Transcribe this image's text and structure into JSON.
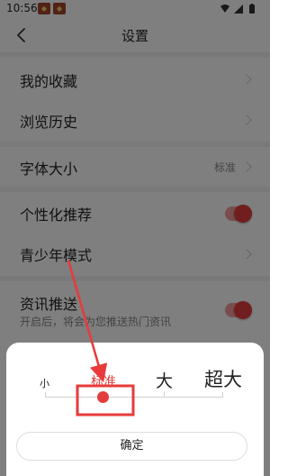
{
  "status_bar": {
    "time": "10:56"
  },
  "header": {
    "title": "设置"
  },
  "settings": {
    "favorites": "我的收藏",
    "history": "浏览历史",
    "font_size": {
      "label": "字体大小",
      "value": "标准"
    },
    "personalized": "个性化推荐",
    "teen_mode": "青少年模式",
    "news_push": {
      "label": "资讯推送",
      "subtitle": "开启后，将会为您推送热门资讯"
    }
  },
  "font_sheet": {
    "options": [
      "小",
      "标准",
      "大",
      "超大"
    ],
    "selected": "标准",
    "confirm_label": "确定"
  },
  "colors": {
    "accent": "#e33c3c",
    "annotation": "#e83a3a"
  }
}
